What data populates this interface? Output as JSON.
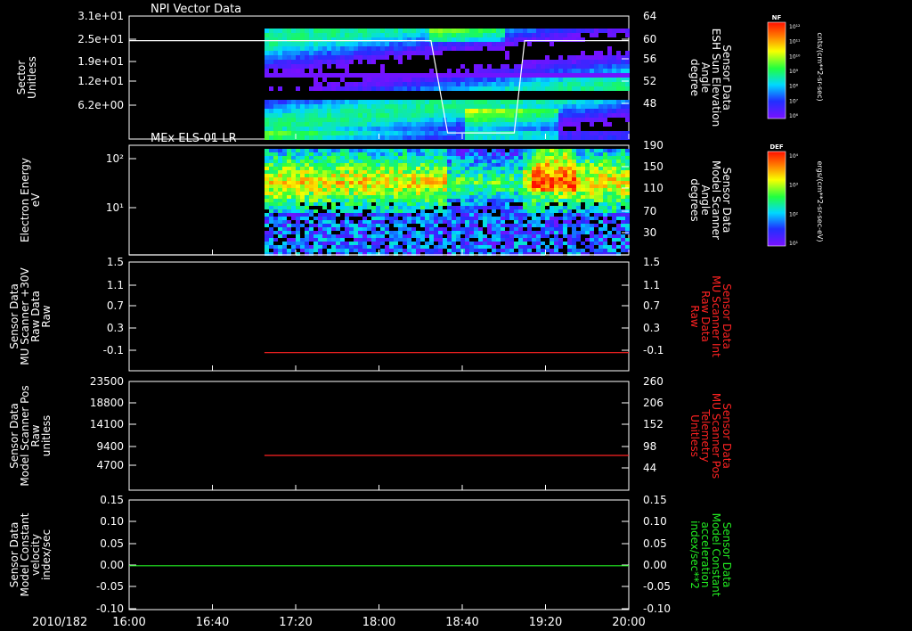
{
  "panels": [
    {
      "id": "npi",
      "title": "NPI Vector Data",
      "ylabel_left": [
        "Sector",
        "Unitless"
      ],
      "yticks_left": [
        "3.1e+01",
        "2.5e+01",
        "1.9e+01",
        "1.2e+01",
        "6.2e+00"
      ],
      "ylabel_right": [
        "Sensor Data",
        "ESH Sun Elevation",
        "Angle",
        "degree"
      ],
      "yticks_right": [
        "64",
        "60",
        "56",
        "52",
        "48"
      ]
    },
    {
      "id": "els",
      "title": "MEx ELS-01 LR",
      "ylabel_left": [
        "Electron Energy",
        "eV"
      ],
      "yticks_left": [
        "10²",
        "10¹"
      ],
      "ylabel_right": [
        "Sensor Data",
        "Model Scanner",
        "Angle",
        "degrees"
      ],
      "yticks_right": [
        "190",
        "150",
        "110",
        "70",
        "30"
      ]
    },
    {
      "id": "scan30",
      "title": "",
      "ylabel_left": [
        "Sensor Data",
        "MU Scanner +30V",
        "Raw Data",
        "Raw"
      ],
      "yticks_left": [
        "1.5",
        "1.1",
        "0.7",
        "0.3",
        "-0.1"
      ],
      "ylabel_right": [
        "Sensor Data",
        "MU Scanner Int",
        "Raw Data",
        "Raw"
      ],
      "yticks_right": [
        "1.5",
        "1.1",
        "0.7",
        "0.3",
        "-0.1"
      ]
    },
    {
      "id": "scanpos",
      "title": "",
      "ylabel_left": [
        "Sensor Data",
        "Model Scanner Pos",
        "Raw",
        "unitless"
      ],
      "yticks_left": [
        "23500",
        "18800",
        "14100",
        "9400",
        "4700"
      ],
      "ylabel_right": [
        "Sensor Data",
        "MU Scanner Pos",
        "Telemetry",
        "Unitless"
      ],
      "yticks_right": [
        "260",
        "206",
        "152",
        "98",
        "44"
      ]
    },
    {
      "id": "const",
      "title": "",
      "ylabel_left": [
        "Sensor Data",
        "Model Constant",
        "velocity",
        "index/sec"
      ],
      "yticks_left": [
        "0.15",
        "0.10",
        "0.05",
        "0.00",
        "-0.05",
        "-0.10"
      ],
      "ylabel_right": [
        "Sensor Data",
        "Model Constant",
        "acceleration",
        "index/sec**2"
      ],
      "yticks_right": [
        "0.15",
        "0.10",
        "0.05",
        "0.00",
        "-0.05",
        "-0.10"
      ]
    }
  ],
  "colorbars": [
    {
      "label": "NF",
      "units": "cnts/(cm**2-sr-sec)",
      "ticks": [
        "10¹²",
        "10¹¹",
        "10¹⁰",
        "10⁹",
        "10⁸",
        "10⁷",
        "10⁶"
      ]
    },
    {
      "label": "DEF",
      "units": "ergs/(cm**2-sr-sec-eV)",
      "ticks": [
        "10⁴",
        "10³",
        "10²",
        "10¹"
      ]
    }
  ],
  "time_axis": {
    "date": "2010/182",
    "labels": [
      "16:00",
      "16:40",
      "17:20",
      "18:00",
      "18:40",
      "19:20",
      "20:00"
    ]
  },
  "colors": {
    "white": "#ffffff",
    "red": "#ff2222",
    "green": "#22ee22",
    "background": "#000000"
  },
  "chart_data": [
    {
      "type": "heatmap",
      "title": "NPI Vector Data",
      "x_range": [
        "16:00",
        "20:00"
      ],
      "data_start": "17:05",
      "ylabel": "Sector Unitless",
      "overlay_series": {
        "name": "ESH Sun Elevation Angle",
        "points": [
          [
            "16:00",
            60
          ],
          [
            "18:25",
            60
          ],
          [
            "18:33",
            45
          ],
          [
            "19:05",
            45
          ],
          [
            "19:10",
            60
          ],
          [
            "20:00",
            60
          ]
        ],
        "ylim": [
          44,
          64
        ]
      }
    },
    {
      "type": "heatmap",
      "title": "MEx ELS-01 LR",
      "x_range": [
        "16:00",
        "20:00"
      ],
      "data_start": "17:05",
      "ylabel": "Electron Energy eV",
      "overlay_series": {
        "name": "Model Scanner Angle",
        "points": [
          [
            "16:00",
            10
          ],
          [
            "20:00",
            10
          ]
        ],
        "ylim": [
          10,
          190
        ]
      }
    },
    {
      "type": "line",
      "series": [
        {
          "name": "MU Scanner Int Raw Data",
          "points": [
            [
              "17:05",
              0.0
            ],
            [
              "20:00",
              0.0
            ]
          ]
        }
      ],
      "ylim": [
        -0.3,
        1.5
      ]
    },
    {
      "type": "line",
      "series": [
        {
          "name": "MU Scanner Pos Telemetry",
          "points": [
            [
              "17:05",
              90
            ],
            [
              "20:00",
              90
            ]
          ]
        }
      ],
      "ylim": [
        10,
        260
      ]
    },
    {
      "type": "line",
      "series": [
        {
          "name": "Model Constant acceleration",
          "points": [
            [
              "16:00",
              0.0
            ],
            [
              "20:00",
              0.0
            ]
          ]
        }
      ],
      "ylim": [
        -0.1,
        0.15
      ]
    }
  ]
}
